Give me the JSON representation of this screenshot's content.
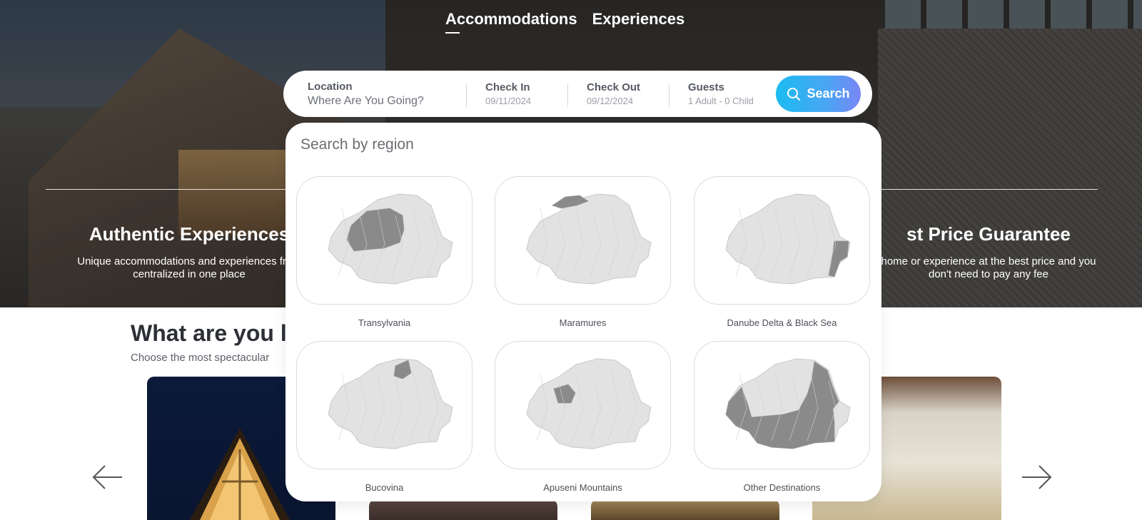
{
  "nav": {
    "tabs": [
      {
        "label": "Accommodations",
        "active": true
      },
      {
        "label": "Experiences",
        "active": false
      }
    ]
  },
  "search": {
    "location_label": "Location",
    "location_placeholder": "Where Are You Going?",
    "checkin_label": "Check In",
    "checkin_value": "09/11/2024",
    "checkout_label": "Check Out",
    "checkout_value": "09/12/2024",
    "guests_label": "Guests",
    "guests_value": "1 Adult - 0 Child",
    "button_label": "Search",
    "button_color_start": "#1bbcf1",
    "button_color_end": "#7a86f5"
  },
  "region_panel": {
    "title": "Search by region",
    "regions": [
      {
        "name": "Transylvania",
        "icon": "transylvania-map-icon"
      },
      {
        "name": "Maramures",
        "icon": "maramures-map-icon"
      },
      {
        "name": "Danube Delta & Black Sea",
        "icon": "danube-delta-map-icon"
      },
      {
        "name": "Bucovina",
        "icon": "bucovina-map-icon"
      },
      {
        "name": "Apuseni Mountains",
        "icon": "apuseni-map-icon"
      },
      {
        "name": "Other Destinations",
        "icon": "other-destinations-map-icon"
      }
    ],
    "highlight_color": "#8a8a8a",
    "base_map_color": "#e2e2e2"
  },
  "features": {
    "left": {
      "title": "Authentic Experiences",
      "text": "Unique accommodations and experiences from",
      "text2": "centralized in one place"
    },
    "right": {
      "title": "st Price Guarantee",
      "text": "home or experience at the best price and you",
      "text2": "don't need to pay any fee"
    }
  },
  "section": {
    "title": "What are you l",
    "subtitle": "Choose the most spectacular"
  }
}
